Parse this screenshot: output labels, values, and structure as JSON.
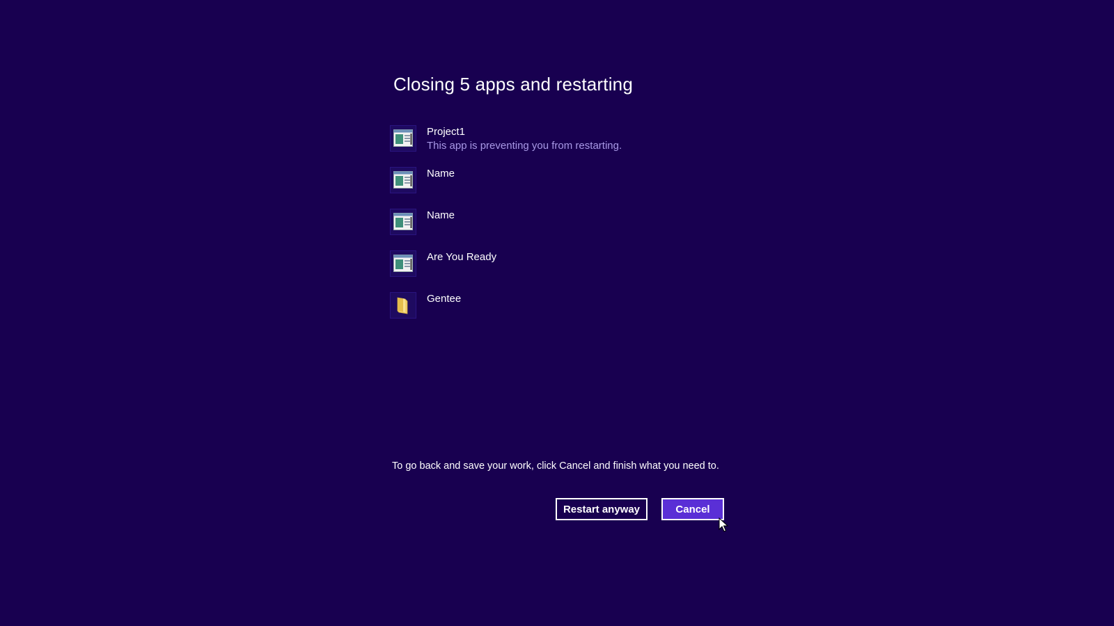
{
  "dialog": {
    "title": "Closing 5 apps and restarting",
    "instruction": "To go back and save your work, click Cancel and finish what you need to."
  },
  "apps": [
    {
      "name": "Project1",
      "note": "This app is preventing you from restarting.",
      "icon": "app-window-icon"
    },
    {
      "name": "Name",
      "note": "",
      "icon": "app-window-icon"
    },
    {
      "name": "Name",
      "note": "",
      "icon": "app-window-icon"
    },
    {
      "name": "Are You Ready",
      "note": "",
      "icon": "app-window-icon"
    },
    {
      "name": "Gentee",
      "note": "",
      "icon": "folder-icon"
    }
  ],
  "buttons": {
    "restart_label": "Restart anyway",
    "cancel_label": "Cancel"
  },
  "colors": {
    "background": "#180050",
    "accent": "#5a2fd6",
    "note_text": "#a899e6"
  }
}
